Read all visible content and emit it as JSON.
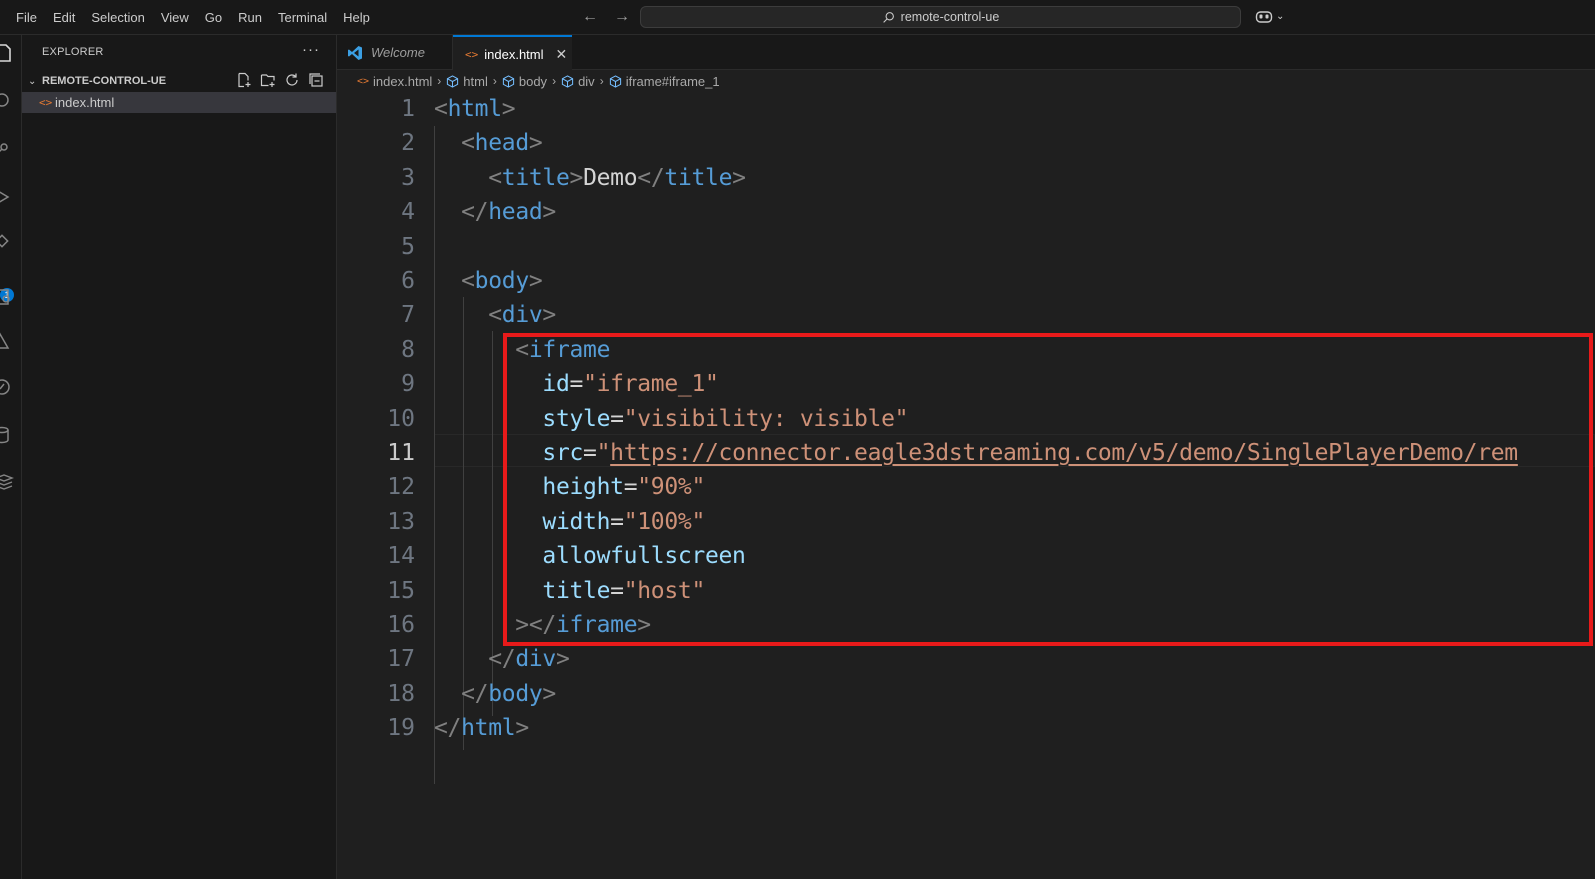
{
  "menu": [
    "File",
    "Edit",
    "Selection",
    "View",
    "Go",
    "Run",
    "Terminal",
    "Help"
  ],
  "search": {
    "text": "remote-control-ue"
  },
  "sidebar": {
    "title": "EXPLORER",
    "more": "···",
    "section": "REMOTE-CONTROL-UE",
    "files": [
      {
        "name": "index.html",
        "selected": true
      }
    ]
  },
  "activity_badge": "1",
  "tabs": [
    {
      "label": "Welcome",
      "active": false
    },
    {
      "label": "index.html",
      "active": true
    }
  ],
  "breadcrumb": [
    "index.html",
    "html",
    "body",
    "div",
    "iframe#iframe_1"
  ],
  "editor": {
    "active_line": 11,
    "lines": [
      {
        "n": "1",
        "tokens": [
          [
            "brk",
            "<"
          ],
          [
            "tag",
            "html"
          ],
          [
            "brk",
            ">"
          ]
        ]
      },
      {
        "n": "2",
        "tokens": [
          [
            "txt",
            "  "
          ],
          [
            "brk",
            "<"
          ],
          [
            "tag",
            "head"
          ],
          [
            "brk",
            ">"
          ]
        ]
      },
      {
        "n": "3",
        "tokens": [
          [
            "txt",
            "    "
          ],
          [
            "brk",
            "<"
          ],
          [
            "tag",
            "title"
          ],
          [
            "brk",
            ">"
          ],
          [
            "txt",
            "Demo"
          ],
          [
            "brk",
            "</"
          ],
          [
            "tag",
            "title"
          ],
          [
            "brk",
            ">"
          ]
        ]
      },
      {
        "n": "4",
        "tokens": [
          [
            "txt",
            "  "
          ],
          [
            "brk",
            "</"
          ],
          [
            "tag",
            "head"
          ],
          [
            "brk",
            ">"
          ]
        ]
      },
      {
        "n": "5",
        "tokens": []
      },
      {
        "n": "6",
        "tokens": [
          [
            "txt",
            "  "
          ],
          [
            "brk",
            "<"
          ],
          [
            "tag",
            "body"
          ],
          [
            "brk",
            ">"
          ]
        ]
      },
      {
        "n": "7",
        "tokens": [
          [
            "txt",
            "    "
          ],
          [
            "brk",
            "<"
          ],
          [
            "tag",
            "div"
          ],
          [
            "brk",
            ">"
          ]
        ]
      },
      {
        "n": "8",
        "tokens": [
          [
            "txt",
            "      "
          ],
          [
            "brk",
            "<"
          ],
          [
            "tag",
            "iframe"
          ]
        ]
      },
      {
        "n": "9",
        "tokens": [
          [
            "txt",
            "        "
          ],
          [
            "attr",
            "id"
          ],
          [
            "eq",
            "="
          ],
          [
            "str",
            "\"iframe_1\""
          ]
        ]
      },
      {
        "n": "10",
        "tokens": [
          [
            "txt",
            "        "
          ],
          [
            "attr",
            "style"
          ],
          [
            "eq",
            "="
          ],
          [
            "str",
            "\"visibility: visible\""
          ]
        ]
      },
      {
        "n": "11",
        "tokens": [
          [
            "txt",
            "        "
          ],
          [
            "attr",
            "src"
          ],
          [
            "eq",
            "="
          ],
          [
            "str",
            "\""
          ],
          [
            "url",
            "https://connector.eagle3dstreaming.com/v5/demo/SinglePlayerDemo/rem"
          ]
        ]
      },
      {
        "n": "12",
        "tokens": [
          [
            "txt",
            "        "
          ],
          [
            "attr",
            "height"
          ],
          [
            "eq",
            "="
          ],
          [
            "str",
            "\"90%\""
          ]
        ]
      },
      {
        "n": "13",
        "tokens": [
          [
            "txt",
            "        "
          ],
          [
            "attr",
            "width"
          ],
          [
            "eq",
            "="
          ],
          [
            "str",
            "\"100%\""
          ]
        ]
      },
      {
        "n": "14",
        "tokens": [
          [
            "txt",
            "        "
          ],
          [
            "attr",
            "allowfullscreen"
          ]
        ]
      },
      {
        "n": "15",
        "tokens": [
          [
            "txt",
            "        "
          ],
          [
            "attr",
            "title"
          ],
          [
            "eq",
            "="
          ],
          [
            "str",
            "\"host\""
          ]
        ]
      },
      {
        "n": "16",
        "tokens": [
          [
            "txt",
            "      "
          ],
          [
            "brk",
            "></"
          ],
          [
            "tag",
            "iframe"
          ],
          [
            "brk",
            ">"
          ]
        ]
      },
      {
        "n": "17",
        "tokens": [
          [
            "txt",
            "    "
          ],
          [
            "brk",
            "</"
          ],
          [
            "tag",
            "div"
          ],
          [
            "brk",
            ">"
          ]
        ]
      },
      {
        "n": "18",
        "tokens": [
          [
            "txt",
            "  "
          ],
          [
            "brk",
            "</"
          ],
          [
            "tag",
            "body"
          ],
          [
            "brk",
            ">"
          ]
        ]
      },
      {
        "n": "19",
        "tokens": [
          [
            "brk",
            "</"
          ],
          [
            "tag",
            "html"
          ],
          [
            "brk",
            ">"
          ]
        ]
      }
    ]
  },
  "colors": {
    "accent": "#0078d4",
    "highlight_border": "#e81a1a",
    "file_icon": "#e37933"
  }
}
